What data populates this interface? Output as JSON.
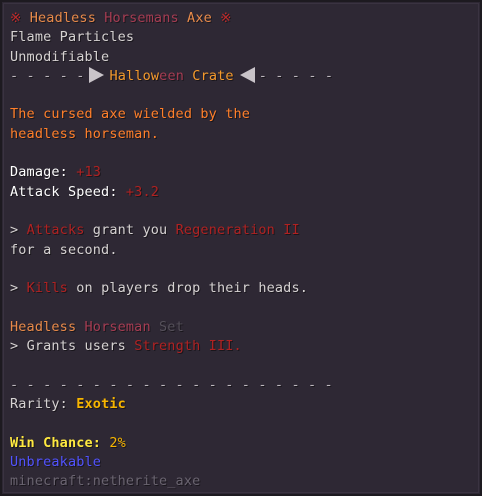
{
  "title": {
    "deco_left": "※",
    "part1": "Headless",
    "part2": "Horsemans",
    "part3": "Axe",
    "deco_right": "※"
  },
  "effects": [
    "Flame Particles",
    "Unmodifiable"
  ],
  "crate_line": {
    "dashes_left": "- - - - -",
    "label_a": "Hallow",
    "label_b": "een",
    "label_c": "Crate",
    "dashes_right": "- - - - -"
  },
  "lore": [
    "The cursed axe wielded by the",
    "headless horseman."
  ],
  "stats": {
    "damage_label": "Damage:",
    "damage_value": "+13",
    "speed_label": "Attack Speed:",
    "speed_value": "+3.2"
  },
  "abilities": [
    {
      "bullet": ">",
      "key": "Attacks",
      "mid": "grant you",
      "effect": "Regeneration II",
      "continuation": "for a second."
    },
    {
      "bullet": ">",
      "key": "Kills",
      "mid": "on players drop their heads."
    }
  ],
  "set": {
    "name1": "Headless",
    "name2": "Horseman",
    "suffix": "Set",
    "bullet": ">",
    "grants": "Grants users",
    "effect": "Strength III."
  },
  "separator": "- - - - - - - - - - - - - - - - - - - -",
  "rarity": {
    "label": "Rarity:",
    "value": "Exotic"
  },
  "win_chance": {
    "label": "Win Chance:",
    "value": "2%"
  },
  "unbreakable": "Unbreakable",
  "item_id": "minecraft:netherite_axe",
  "colors": {
    "background": "#2e2834",
    "title_deco": "#c42a2a",
    "lore": "#ff7f2a",
    "ability_red": "#b02222",
    "rarity_gold": "#f7b500",
    "win_yellow": "#ffe940",
    "unbreakable_blue": "#5253ff"
  }
}
